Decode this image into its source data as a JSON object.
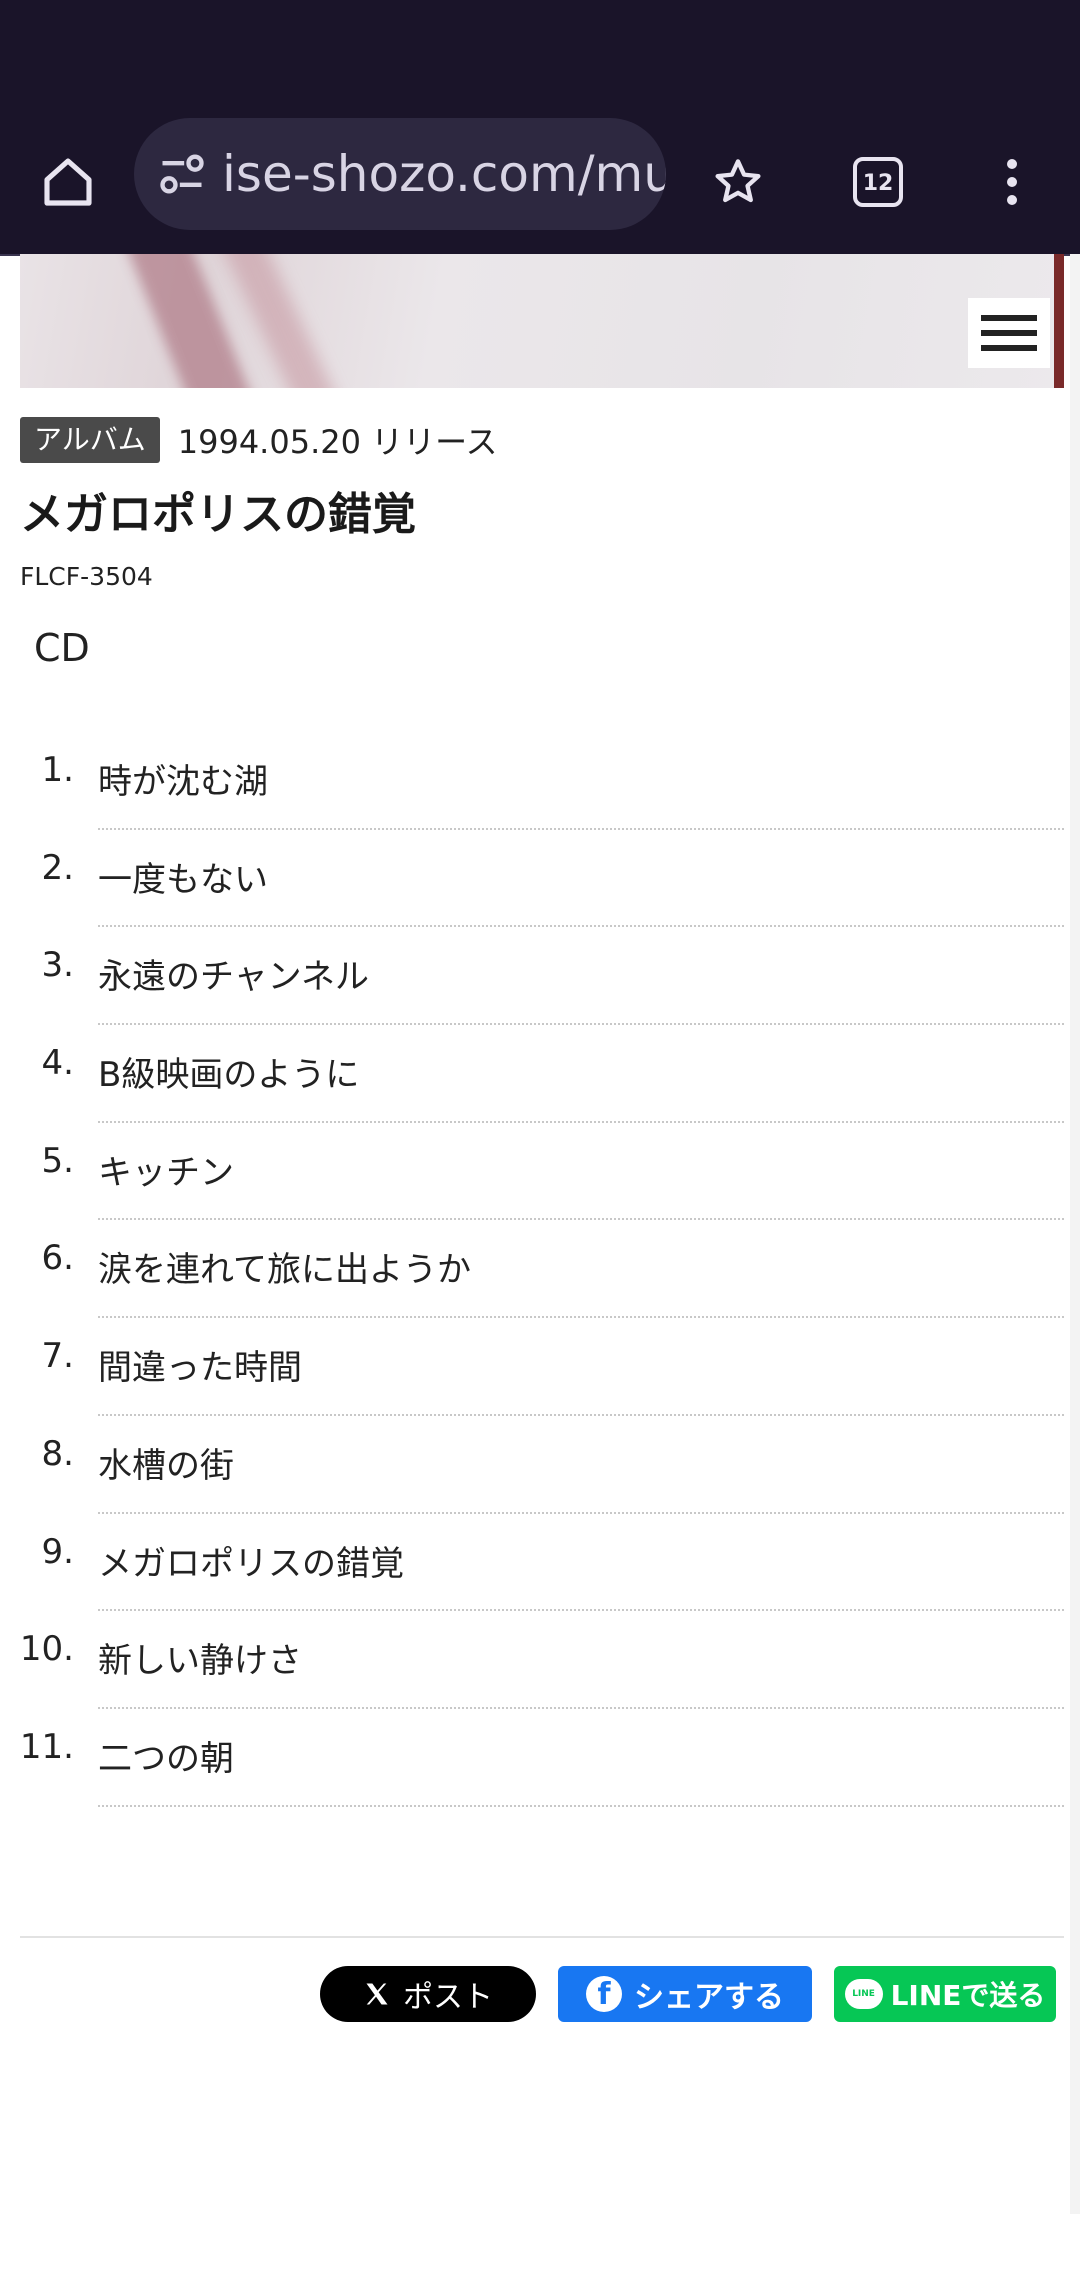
{
  "browser": {
    "url": "ise-shozo.com/mu",
    "tab_count": "12"
  },
  "album": {
    "type_badge": "アルバム",
    "release": "1994.05.20 リリース",
    "title": "メガロポリスの錯覚",
    "catalog_no": "FLCF-3504",
    "format": "CD"
  },
  "tracks": [
    {
      "num": "1.",
      "name": "時が沈む湖"
    },
    {
      "num": "2.",
      "name": "一度もない"
    },
    {
      "num": "3.",
      "name": "永遠のチャンネル"
    },
    {
      "num": "4.",
      "name": "B級映画のように"
    },
    {
      "num": "5.",
      "name": "キッチン"
    },
    {
      "num": "6.",
      "name": "涙を連れて旅に出ようか"
    },
    {
      "num": "7.",
      "name": "間違った時間"
    },
    {
      "num": "8.",
      "name": "水槽の街"
    },
    {
      "num": "9.",
      "name": "メガロポリスの錯覚"
    },
    {
      "num": "10.",
      "name": "新しい静けさ"
    },
    {
      "num": "11.",
      "name": "二つの朝"
    }
  ],
  "share": {
    "x_label": "ポスト",
    "facebook_label": "シェアする",
    "line_label": "LINEで送る",
    "line_icon_text": "LINE"
  },
  "colors": {
    "browser_bar": "#1a1429",
    "facebook": "#1877f2",
    "line": "#06c755",
    "x": "#000000"
  }
}
